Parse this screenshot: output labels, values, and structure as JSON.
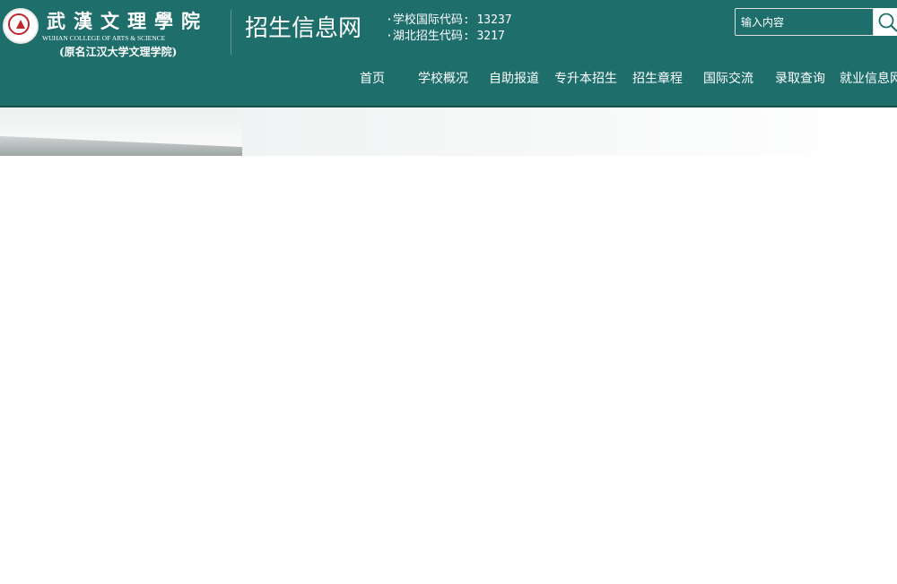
{
  "logo": {
    "name_cn": "武漢文理學院",
    "name_en": "WUHAN COLLEGE OF ARTS & SCIENCE",
    "former_name": "(原名江汉大学文理学院)"
  },
  "site_title": "招生信息网",
  "codes": {
    "international": "·学校国际代码: 13237",
    "hubei": "·湖北招生代码: 3217"
  },
  "search": {
    "placeholder": "输入内容",
    "icon": "search-icon"
  },
  "nav": [
    {
      "label": "首页"
    },
    {
      "label": "学校概况"
    },
    {
      "label": "自助报道"
    },
    {
      "label": "专升本招生"
    },
    {
      "label": "招生章程"
    },
    {
      "label": "国际交流"
    },
    {
      "label": "录取查询"
    },
    {
      "label": "就业信息网"
    }
  ],
  "colors": {
    "header_bg": "#1e6e6c",
    "text": "#ffffff",
    "seal_red": "#c0272d"
  }
}
